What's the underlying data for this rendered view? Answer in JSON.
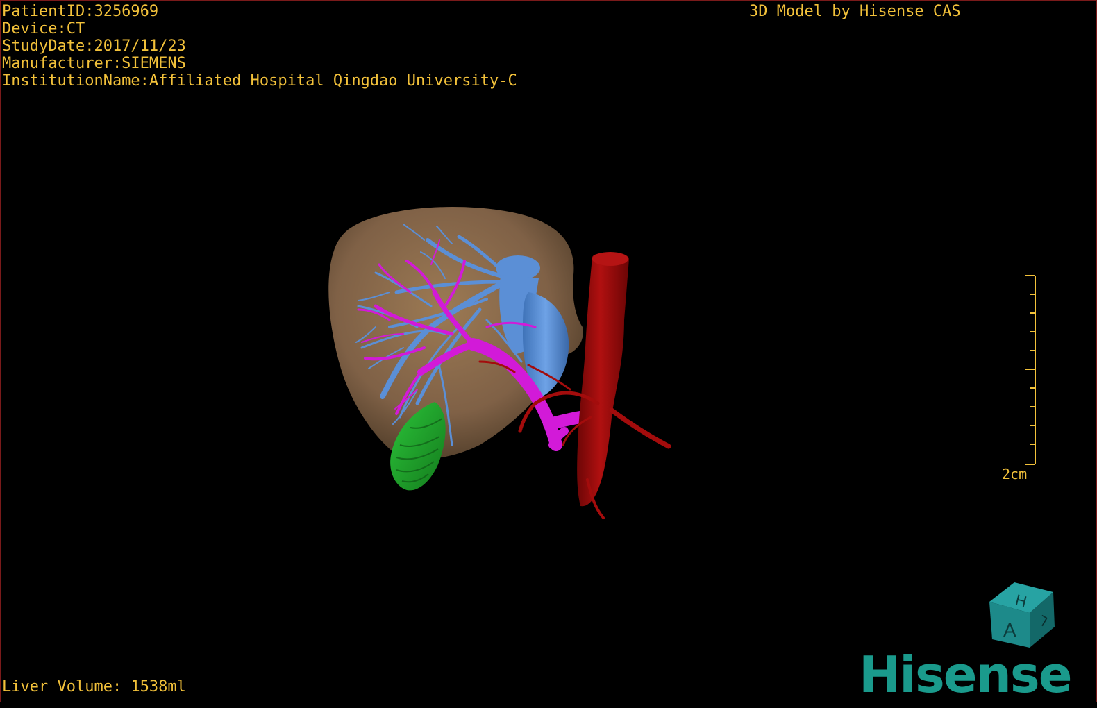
{
  "patient_info": {
    "patient_id": "PatientID:3256969",
    "device": "Device:CT",
    "study_date": "StudyDate:2017/11/23",
    "manufacturer": "Manufacturer:SIEMENS",
    "institution": "InstitutionName:Affiliated Hospital Qingdao University-C"
  },
  "model_credit": "3D Model by Hisense CAS",
  "liver_volume": "Liver Volume: 1538ml",
  "scale": {
    "label": "2cm"
  },
  "orientation_cube": {
    "top_face_letter": "H",
    "front_face_letter": "A",
    "side_face_letter": "L",
    "color": "#1d8a8a"
  },
  "brand": {
    "name": "Hisense",
    "color": "#1a9a8c"
  },
  "colors": {
    "overlay_text": "#f2c13a",
    "liver": "#8a6a48",
    "hepatic_vein": "#5b8fd6",
    "portal_vein": "#d21ad8",
    "artery_ivc": "#a30c0c",
    "gallbladder": "#1f9a2a",
    "background": "#000000"
  },
  "icons": {
    "orientation_cube": "orientation-cube-icon",
    "scale_bar": "ruler-icon"
  }
}
